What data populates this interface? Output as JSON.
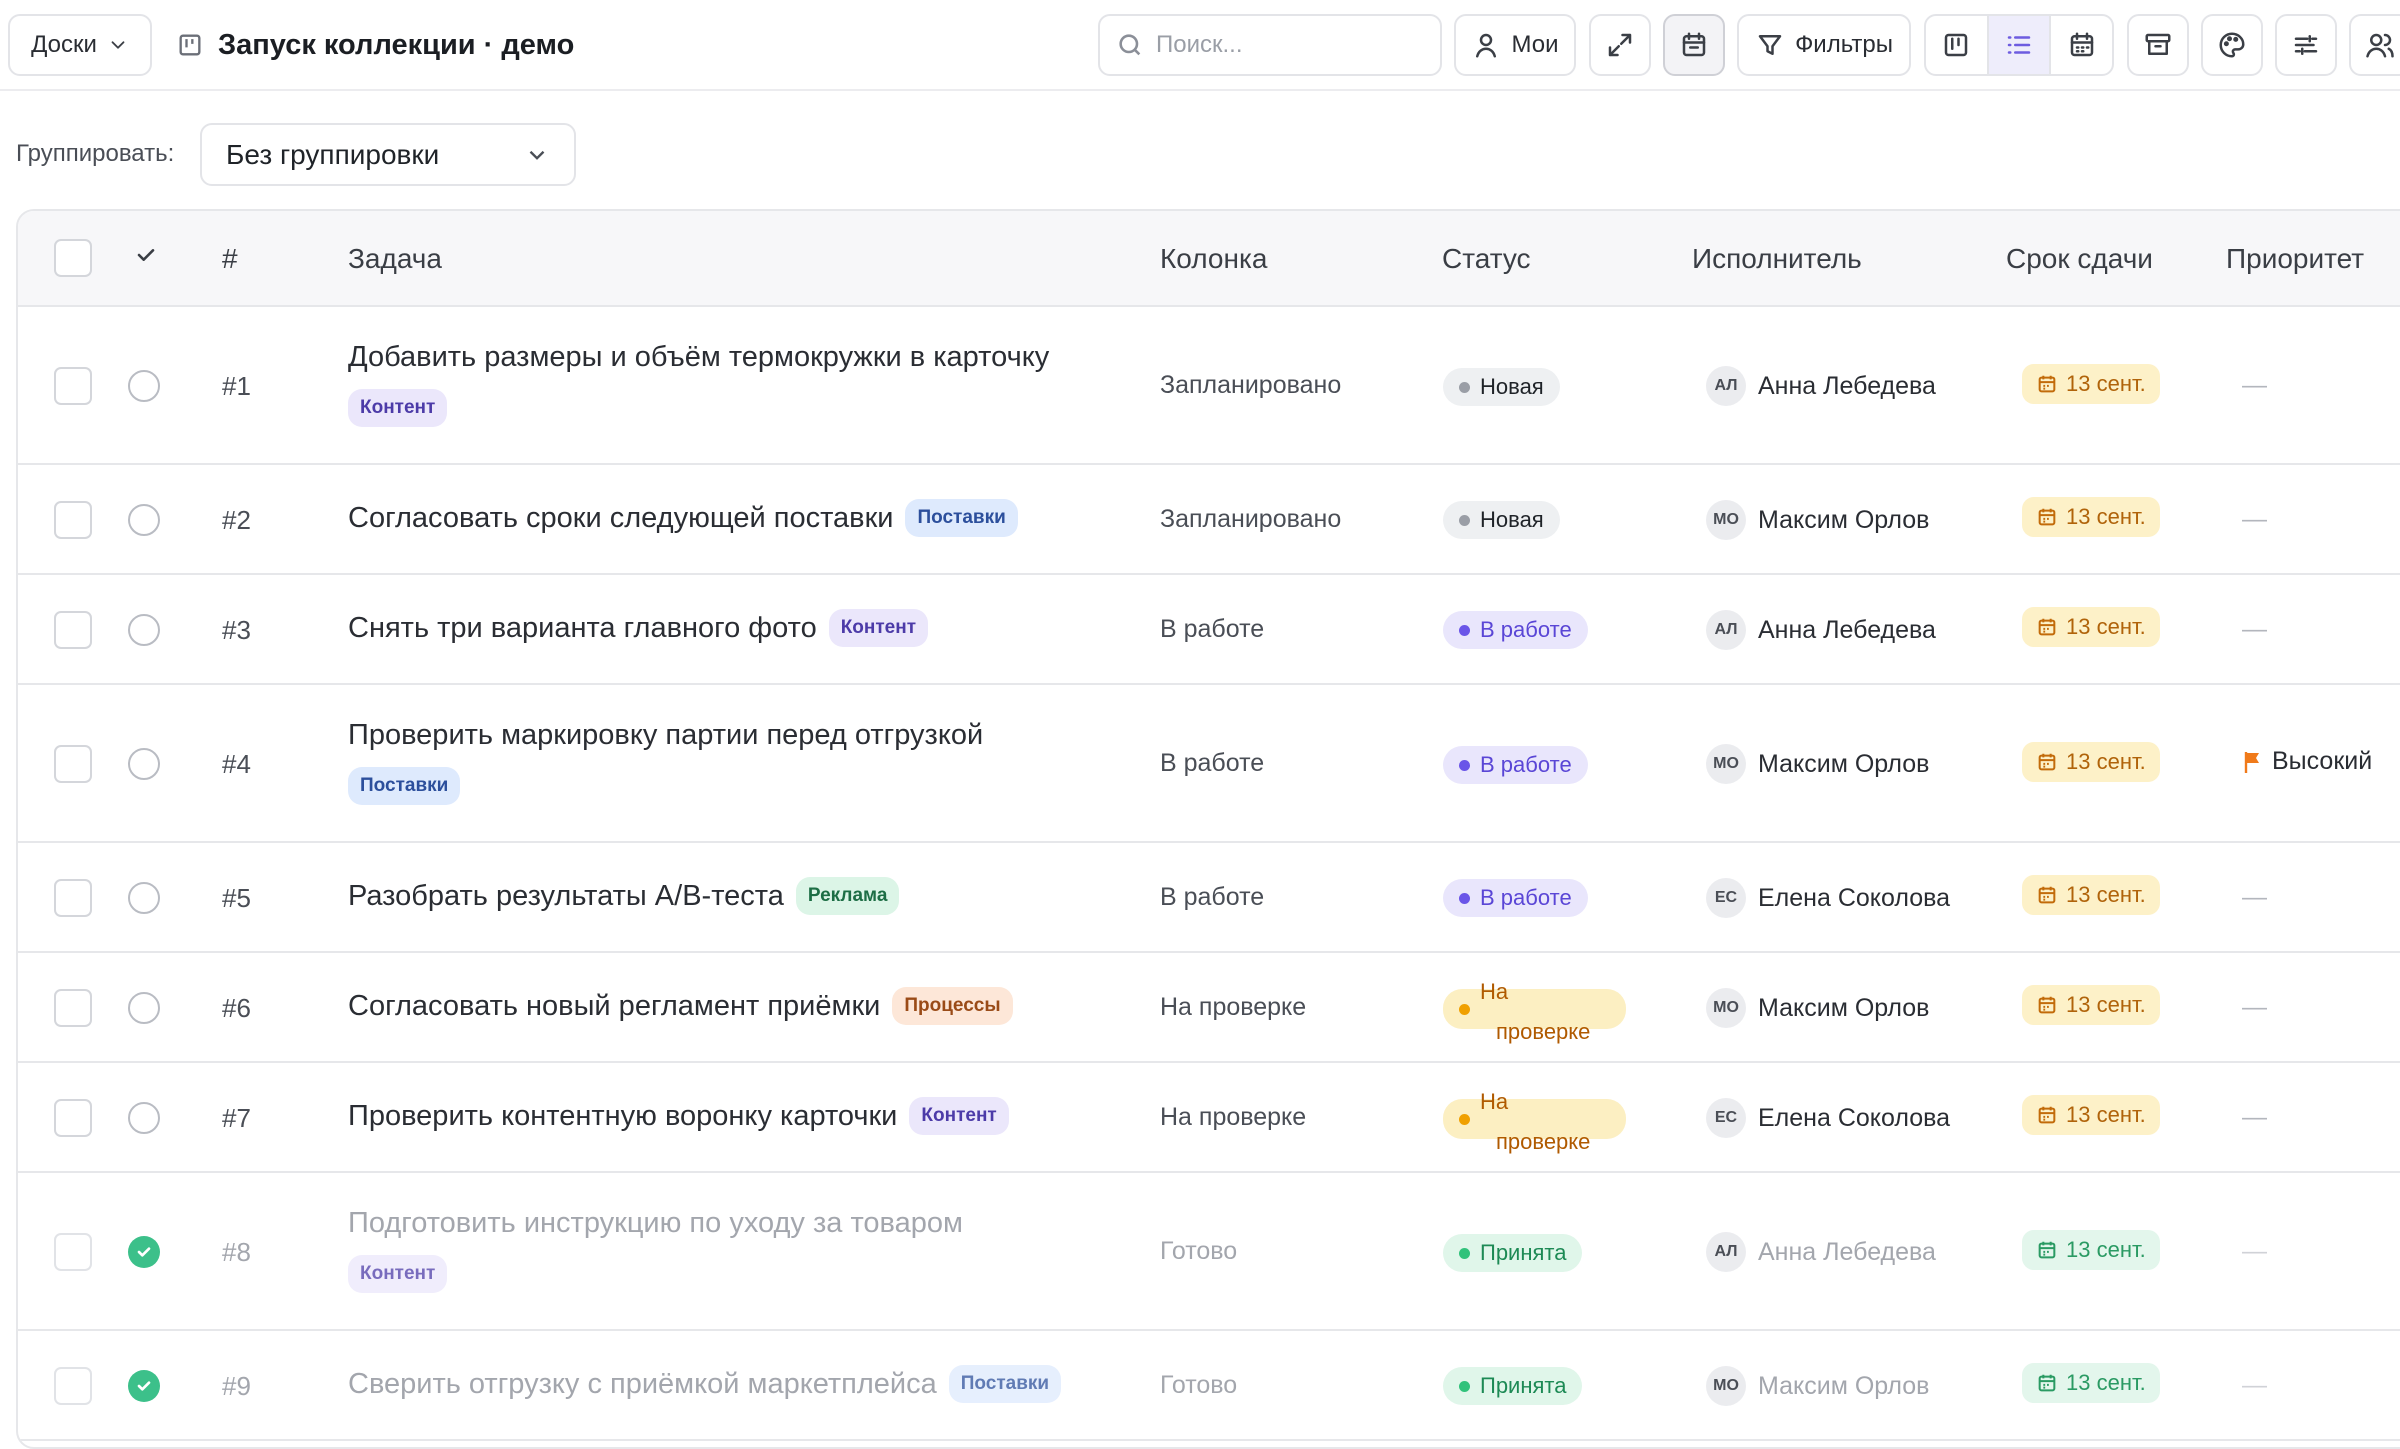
{
  "topbar": {
    "boards_label": "Доски",
    "board_title": "Запуск коллекции · демо",
    "search_placeholder": "Поиск...",
    "mine_label": "Мои",
    "filters_label": "Фильтры"
  },
  "group": {
    "label": "Группировать:",
    "value": "Без группировки"
  },
  "table": {
    "headers": {
      "num": "#",
      "task": "Задача",
      "column": "Колонка",
      "status": "Статус",
      "assignee": "Исполнитель",
      "due": "Срок сдачи",
      "priority": "Приоритет"
    },
    "rows": [
      {
        "num": "#1",
        "title": "Добавить размеры и объём термокружки в карточку",
        "tag": "Контент",
        "column": "Запланировано",
        "status": "Новая",
        "initials": "АЛ",
        "assignee": "Анна Лебедева",
        "due": "13 сент.",
        "priority": "—"
      },
      {
        "num": "#2",
        "title": "Согласовать сроки следующей поставки",
        "tag": "Поставки",
        "column": "Запланировано",
        "status": "Новая",
        "initials": "МО",
        "assignee": "Максим Орлов",
        "due": "13 сент.",
        "priority": "—"
      },
      {
        "num": "#3",
        "title": "Снять три варианта главного фото",
        "tag": "Контент",
        "column": "В работе",
        "status": "В работе",
        "initials": "АЛ",
        "assignee": "Анна Лебедева",
        "due": "13 сент.",
        "priority": "—"
      },
      {
        "num": "#4",
        "title": "Проверить маркировку партии перед отгрузкой",
        "tag": "Поставки",
        "column": "В работе",
        "status": "В работе",
        "initials": "МО",
        "assignee": "Максим Орлов",
        "due": "13 сент.",
        "priority": "Высокий"
      },
      {
        "num": "#5",
        "title": "Разобрать результаты A/B-теста",
        "tag": "Реклама",
        "column": "В работе",
        "status": "В работе",
        "initials": "ЕС",
        "assignee": "Елена Соколова",
        "due": "13 сент.",
        "priority": "—"
      },
      {
        "num": "#6",
        "title": "Согласовать новый регламент приёмки",
        "tag": "Процессы",
        "column": "На проверке",
        "status_line1": "На",
        "status_line2": "проверке",
        "initials": "МО",
        "assignee": "Максим Орлов",
        "due": "13 сент.",
        "priority": "—"
      },
      {
        "num": "#7",
        "title": "Проверить контентную воронку карточки",
        "tag": "Контент",
        "column": "На проверке",
        "status_line1": "На",
        "status_line2": "проверке",
        "initials": "ЕС",
        "assignee": "Елена Соколова",
        "due": "13 сент.",
        "priority": "—"
      },
      {
        "num": "#8",
        "title": "Подготовить инструкцию по уходу за товаром",
        "tag": "Контент",
        "column": "Готово",
        "status": "Принята",
        "initials": "АЛ",
        "assignee": "Анна Лебедева",
        "due": "13 сент.",
        "priority": "—"
      },
      {
        "num": "#9",
        "title": "Сверить отгрузку с приёмкой маркетплейса",
        "tag": "Поставки",
        "column": "Готово",
        "status": "Принята",
        "initials": "МО",
        "assignee": "Максим Орлов",
        "due": "13 сент.",
        "priority": "—"
      }
    ]
  },
  "colors": {
    "accent": "#6d5ce0",
    "done_green": "#3cc08a",
    "priority_high": "#f07a1a"
  }
}
